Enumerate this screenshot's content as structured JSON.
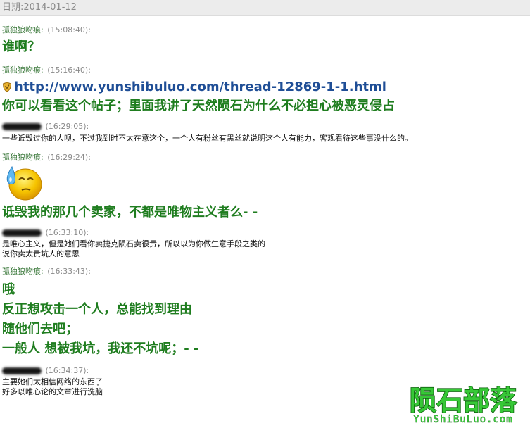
{
  "date_bar": {
    "label": "日期:2014-01-12"
  },
  "messages": [
    {
      "sender": "孤独狼吻痕:",
      "time": "(15:08:40):",
      "lines": [
        "谁啊？"
      ]
    },
    {
      "sender": "孤独狼吻痕:",
      "time": "(15:16:40):",
      "link": "http://www.yunshibuluo.com/thread-12869-1-1.html",
      "lines": [
        "你可以看看这个帖子；里面我讲了天然陨石为什么不必担心被恶灵侵占"
      ]
    },
    {
      "sender": "",
      "time": "(16:29:05):",
      "lines": [
        "一些诋毁过你的人呗，不过我到时不太在意这个，一个人有粉丝有黑丝就说明这个人有能力，客观看待这些事没什么的。"
      ]
    },
    {
      "sender": "孤独狼吻痕:",
      "time": "(16:29:24):",
      "lines": [
        "诋毁我的那几个卖家，不都是唯物主义者么- -"
      ]
    },
    {
      "sender": "",
      "time": "(16:33:10):",
      "lines": [
        "是唯心主义，但是她们看你卖捷克陨石卖很贵，所以以为你做生意手段之类的",
        "说你卖太贵坑人的意思"
      ]
    },
    {
      "sender": "孤独狼吻痕:",
      "time": "(16:33:43):",
      "lines": [
        "哦",
        "反正想攻击一个人，总能找到理由",
        "随他们去吧；",
        "一般人 想被我坑，我还不坑呢；- -"
      ]
    },
    {
      "sender": "",
      "time": "(16:34:37):",
      "lines": [
        "主要她们太相信网络的东西了",
        "好多以唯心论的文章进行洗脑"
      ]
    }
  ],
  "watermark": {
    "title": "陨石部落",
    "subtitle": "YunShiBuLuo.com"
  },
  "colors": {
    "sender": "#3d7a3d",
    "message": "#1f7d1f",
    "link": "#1f4e96",
    "time": "#8a8a8a",
    "date_bar_bg": "#ececec"
  },
  "icons": {
    "link_prefix": "shield-icon",
    "emoticon": "sweat-face-icon"
  }
}
